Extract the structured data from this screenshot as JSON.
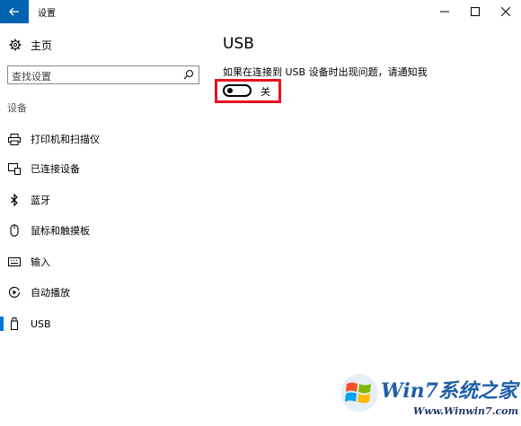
{
  "window": {
    "title": "设置",
    "back_icon": "arrow-left-icon",
    "controls": [
      "minimize-icon",
      "maximize-icon",
      "close-icon"
    ]
  },
  "sidebar": {
    "home_label": "主页",
    "search_placeholder": "查找设置",
    "section_label": "设备",
    "items": [
      {
        "label": "打印机和扫描仪",
        "icon": "printer-icon"
      },
      {
        "label": "已连接设备",
        "icon": "connected-devices-icon"
      },
      {
        "label": "蓝牙",
        "icon": "bluetooth-icon"
      },
      {
        "label": "鼠标和触摸板",
        "icon": "mouse-icon"
      },
      {
        "label": "输入",
        "icon": "keyboard-icon"
      },
      {
        "label": "自动播放",
        "icon": "autoplay-icon"
      },
      {
        "label": "USB",
        "icon": "usb-icon",
        "selected": true
      }
    ]
  },
  "main": {
    "title": "USB",
    "notify_text": "如果在连接到 USB 设备时出现问题，请通知我",
    "toggle_state_label": "关",
    "toggle_on": false
  },
  "watermark": {
    "logo_text": "Win7系统之家",
    "url": "Www.Winwin7.com"
  },
  "colors": {
    "accent": "#0078d7",
    "titlebar_back": "#0063b1",
    "highlight": "#e81123"
  }
}
